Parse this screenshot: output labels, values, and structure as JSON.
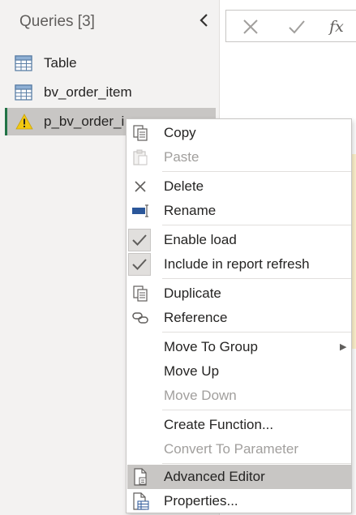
{
  "queries": {
    "title": "Queries [3]",
    "collapse_icon": "chevron-left-icon",
    "items": [
      {
        "label": "Table",
        "icon": "table-icon"
      },
      {
        "label": "bv_order_item",
        "icon": "table-icon"
      },
      {
        "label": "p_bv_order_i",
        "icon": "warning-icon",
        "selected": true
      }
    ]
  },
  "formula_bar": {
    "cancel_icon": "close-icon",
    "commit_icon": "checkmark-icon",
    "fx_label": "fx"
  },
  "context_menu": {
    "copy": "Copy",
    "paste": "Paste",
    "delete": "Delete",
    "rename": "Rename",
    "enable_load": "Enable load",
    "include_refresh": "Include in report refresh",
    "duplicate": "Duplicate",
    "reference": "Reference",
    "move_to_group": "Move To Group",
    "move_up": "Move Up",
    "move_down": "Move Down",
    "create_function": "Create Function...",
    "convert_to_parameter": "Convert To Parameter",
    "advanced_editor": "Advanced Editor",
    "properties": "Properties..."
  },
  "colors": {
    "pane_bg": "#f3f2f1",
    "selected_bg": "#c8c6c4",
    "accent_green": "#217346",
    "warning_yellow": "#f2c811",
    "disabled_text": "#a19f9d"
  }
}
